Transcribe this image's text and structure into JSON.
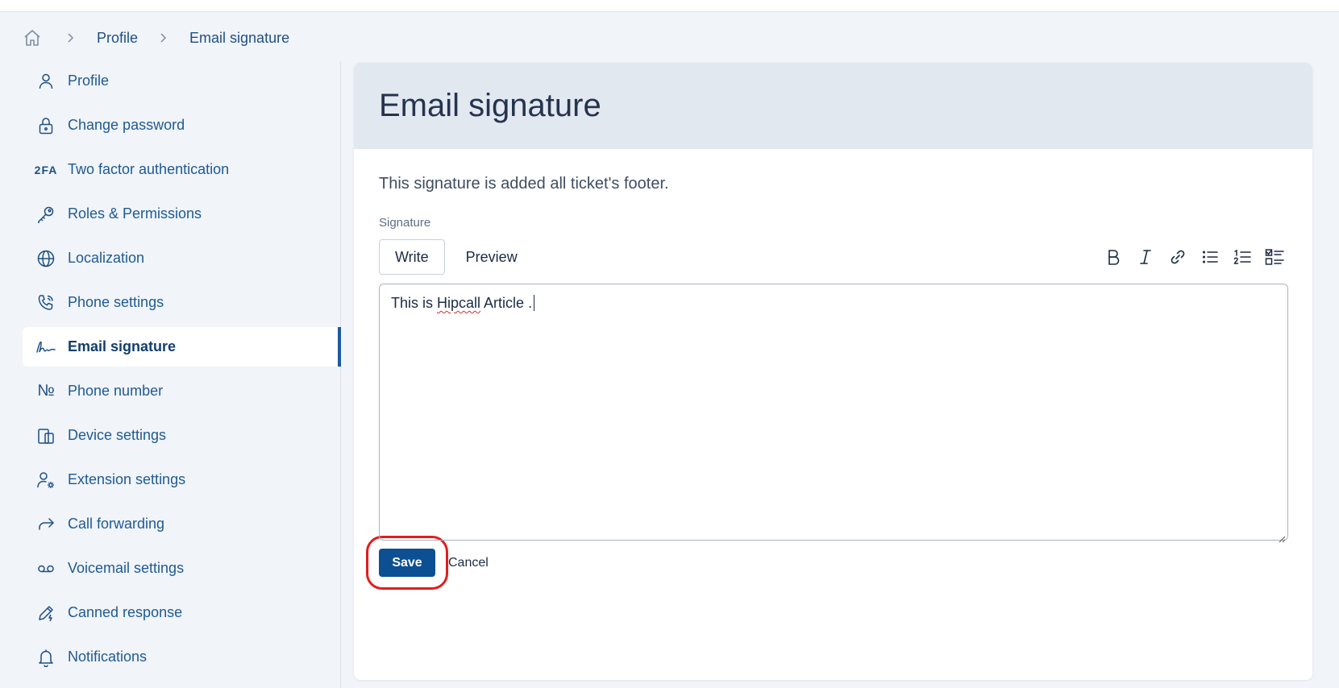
{
  "breadcrumb": {
    "items": [
      "Profile",
      "Email signature"
    ]
  },
  "sidebar": {
    "items": [
      {
        "label": "Profile",
        "icon": "user-icon"
      },
      {
        "label": "Change password",
        "icon": "lock-icon"
      },
      {
        "label": "Two factor authentication",
        "icon": "2fa-icon",
        "icon_text": "2FA"
      },
      {
        "label": "Roles & Permissions",
        "icon": "key-icon"
      },
      {
        "label": "Localization",
        "icon": "globe-icon"
      },
      {
        "label": "Phone settings",
        "icon": "phone-settings-icon"
      },
      {
        "label": "Email signature",
        "icon": "signature-icon",
        "active": true
      },
      {
        "label": "Phone number",
        "icon": "number-sign-icon",
        "icon_text": "№"
      },
      {
        "label": "Device settings",
        "icon": "devices-icon"
      },
      {
        "label": "Extension settings",
        "icon": "user-gear-icon"
      },
      {
        "label": "Call forwarding",
        "icon": "forward-icon"
      },
      {
        "label": "Voicemail settings",
        "icon": "voicemail-icon"
      },
      {
        "label": "Canned response",
        "icon": "pen-bolt-icon"
      },
      {
        "label": "Notifications",
        "icon": "bell-icon"
      }
    ]
  },
  "main": {
    "title": "Email signature",
    "description": "This signature is added all ticket's footer.",
    "field_label": "Signature",
    "tabs": [
      {
        "label": "Write",
        "active": true
      },
      {
        "label": "Preview",
        "active": false
      }
    ],
    "toolbar_icons": [
      "bold-icon",
      "italic-icon",
      "link-icon",
      "bullet-list-icon",
      "numbered-list-icon",
      "task-list-icon"
    ],
    "editor_text_before": "This is ",
    "editor_text_misspelled": "Hipcall",
    "editor_text_after": " Article .",
    "save_label": "Save",
    "cancel_label": "Cancel"
  },
  "colors": {
    "accent": "#0d4f93",
    "highlight": "#e11d1d",
    "header_bg": "#e2e8f0"
  }
}
